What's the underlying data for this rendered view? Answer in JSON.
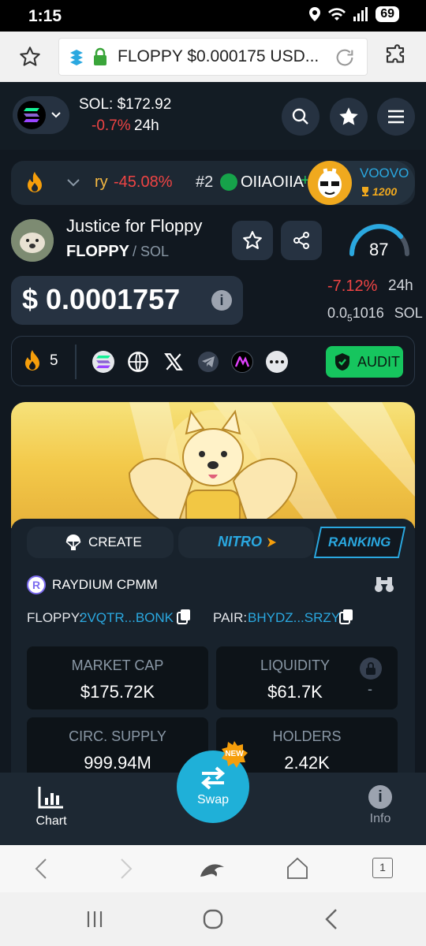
{
  "status": {
    "time": "1:15",
    "battery": "69"
  },
  "browser": {
    "url": "FLOPPY $0.000175 USD..."
  },
  "header": {
    "sol_price": "SOL: $172.92",
    "sol_change": "-0.7%",
    "sol_period": "24h"
  },
  "ticker": {
    "item1_name": "ry",
    "item1_change": "-45.08%",
    "item2_rank": "#2",
    "item2_name": "OIIAOIIA",
    "item2_plus": "+",
    "promo_name": "VOOVO",
    "promo_count": "1200"
  },
  "token": {
    "name": "Justice for Floppy",
    "symbol": "FLOPPY",
    "chain": "/ SOL",
    "score": "87",
    "price": "$ 0.0001757",
    "change": "-7.12%",
    "period": "24h",
    "price_sol_prefix": "0.0",
    "price_sol_sub": "5",
    "price_sol_rest": "1016",
    "price_sol_unit": "SOL"
  },
  "social": {
    "boosts": "5",
    "audit_label": "AUDIT"
  },
  "tabs": {
    "create": "CREATE",
    "nitro": "NITRO",
    "ranking": "RANKING"
  },
  "pool": {
    "dex": "RAYDIUM CPMM",
    "token_label": "FLOPPY:",
    "token_addr": "2VQTR...BONK",
    "pair_label": "PAIR:",
    "pair_addr": "BHYDZ...SRZY"
  },
  "stats": {
    "mcap_label": "MARKET CAP",
    "mcap_value": "$175.72K",
    "liq_label": "LIQUIDITY",
    "liq_value": "$61.7K",
    "liq_extra": "-",
    "supply_label": "CIRC. SUPPLY",
    "supply_value": "999.94M",
    "holders_label": "HOLDERS",
    "holders_value": "2.42K"
  },
  "bottomnav": {
    "chart": "Chart",
    "swap": "Swap",
    "new_badge": "NEW",
    "info": "Info"
  },
  "browser_bottom": {
    "tab_count": "1"
  }
}
